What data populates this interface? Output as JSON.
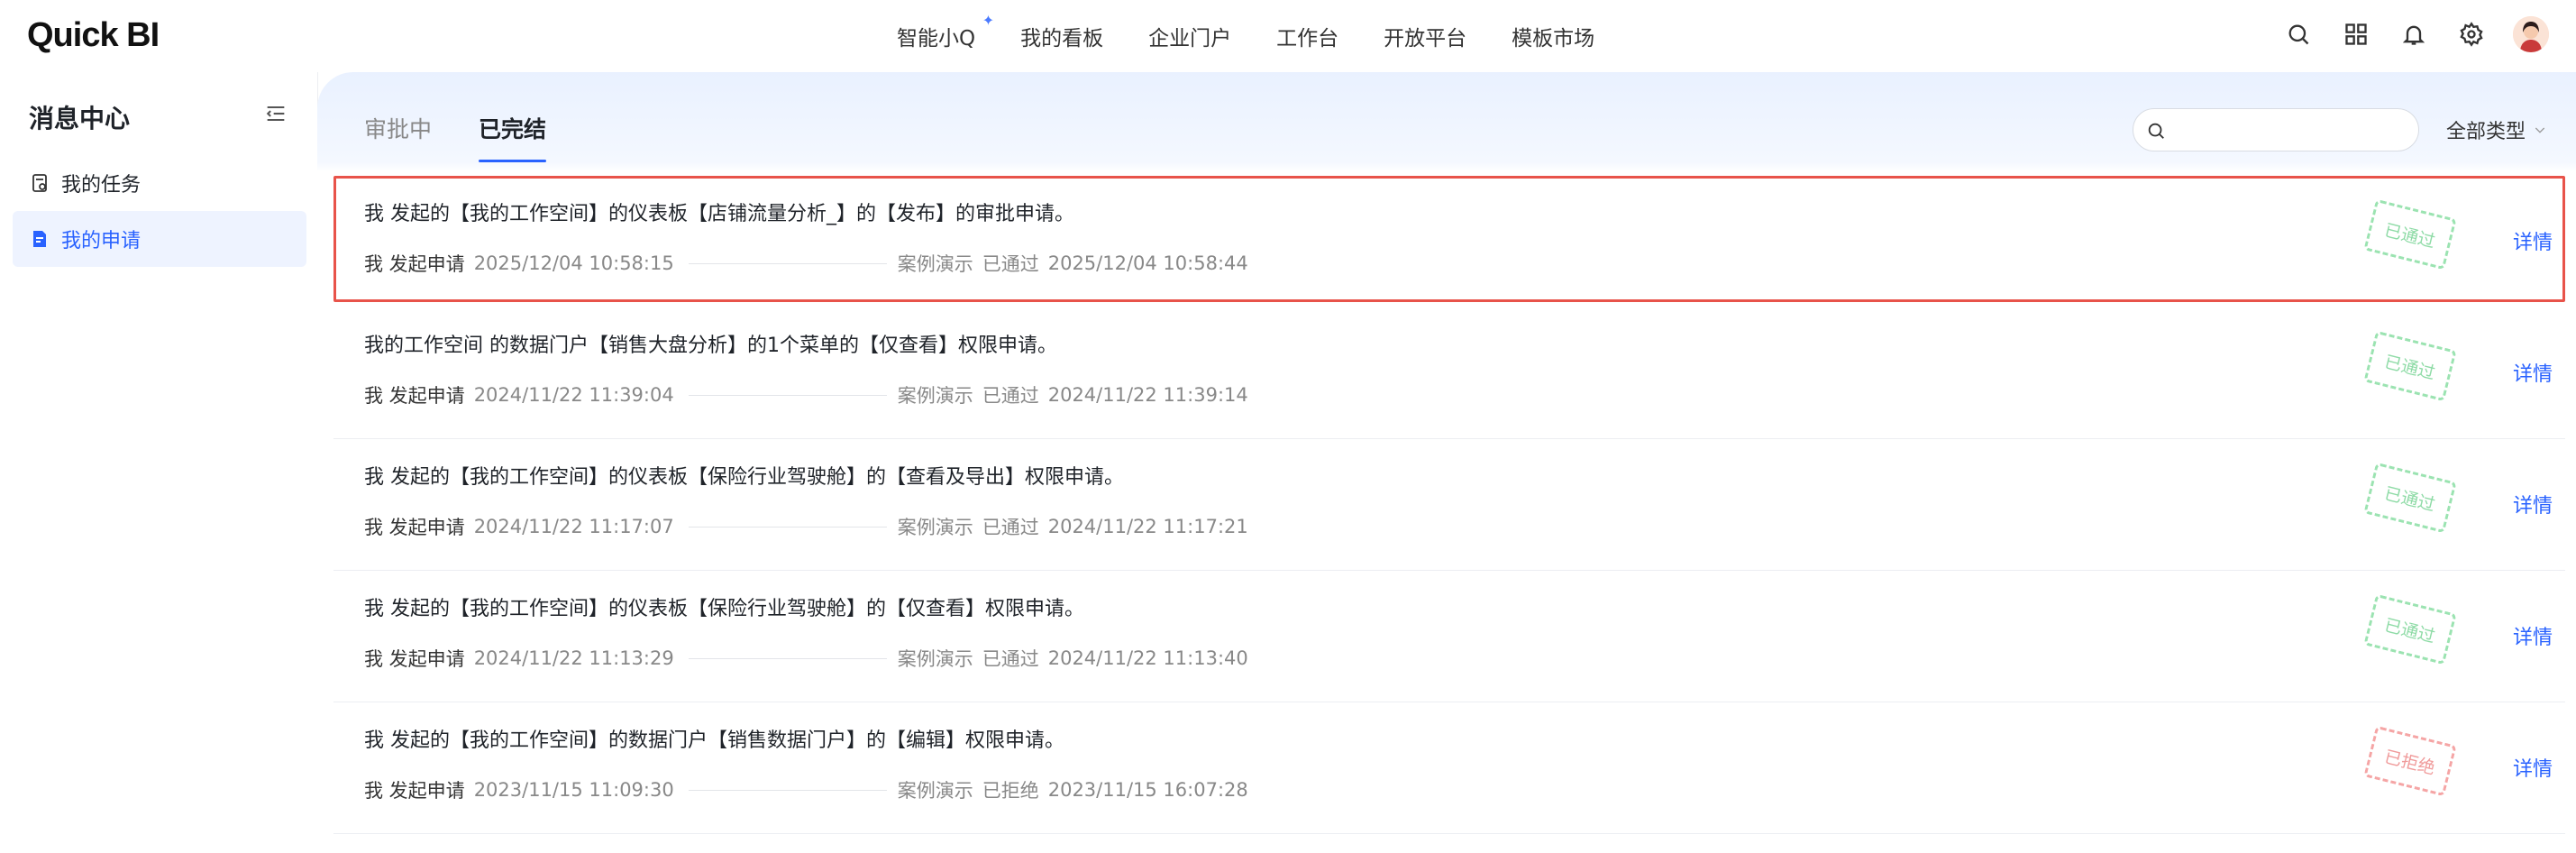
{
  "header": {
    "logo": "Quick BI",
    "nav": [
      "智能小Q",
      "我的看板",
      "企业门户",
      "工作台",
      "开放平台",
      "模板市场"
    ]
  },
  "sidebar": {
    "title": "消息中心",
    "items": [
      {
        "label": "我的任务"
      },
      {
        "label": "我的申请"
      }
    ]
  },
  "main": {
    "tabs": [
      "审批中",
      "已完结"
    ],
    "search_placeholder": "",
    "type_filter": "全部类型",
    "rows": [
      {
        "title": "我 发起的【我的工作空间】的仪表板【店铺流量分析_】的【发布】的审批申请。",
        "who": "我 发起申请",
        "time1": "2025/12/04 10:58:15",
        "project": "案例演示",
        "status": "已通过",
        "time2": "2025/12/04 10:58:44",
        "stamp": "已通过",
        "detail": "详情"
      },
      {
        "title": "我的工作空间 的数据门户【销售大盘分析】的1个菜单的【仅查看】权限申请。",
        "who": "我 发起申请",
        "time1": "2024/11/22 11:39:04",
        "project": "案例演示",
        "status": "已通过",
        "time2": "2024/11/22 11:39:14",
        "stamp": "已通过",
        "detail": "详情"
      },
      {
        "title": "我 发起的【我的工作空间】的仪表板【保险行业驾驶舱】的【查看及导出】权限申请。",
        "who": "我 发起申请",
        "time1": "2024/11/22 11:17:07",
        "project": "案例演示",
        "status": "已通过",
        "time2": "2024/11/22 11:17:21",
        "stamp": "已通过",
        "detail": "详情"
      },
      {
        "title": "我 发起的【我的工作空间】的仪表板【保险行业驾驶舱】的【仅查看】权限申请。",
        "who": "我 发起申请",
        "time1": "2024/11/22 11:13:29",
        "project": "案例演示",
        "status": "已通过",
        "time2": "2024/11/22 11:13:40",
        "stamp": "已通过",
        "detail": "详情"
      },
      {
        "title": "我 发起的【我的工作空间】的数据门户【销售数据门户】的【编辑】权限申请。",
        "who": "我 发起申请",
        "time1": "2023/11/15 11:09:30",
        "project": "案例演示",
        "status": "已拒绝",
        "time2": "2023/11/15 16:07:28",
        "stamp": "已拒绝",
        "detail": "详情"
      }
    ]
  },
  "colors": {
    "accent": "#2962ff",
    "highlight_border": "#e8534a",
    "stamp_pass": "#8edba6",
    "stamp_reject": "#f09b9b"
  }
}
